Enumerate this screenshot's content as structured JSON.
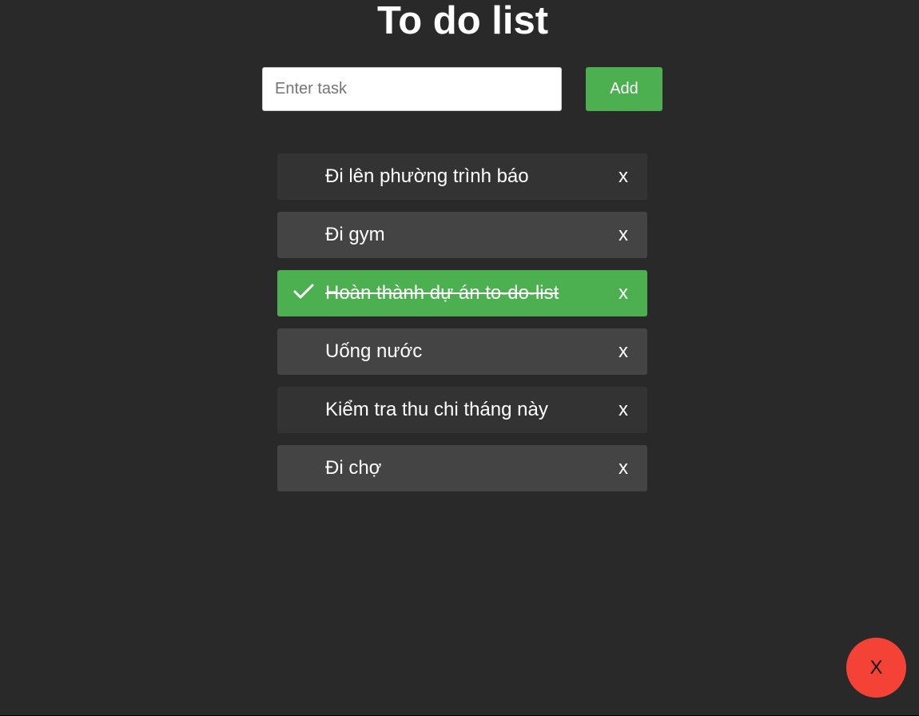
{
  "header": {
    "title": "To do list"
  },
  "form": {
    "input_placeholder": "Enter task",
    "input_value": "",
    "add_label": "Add"
  },
  "todos": [
    {
      "text": "Đi lên phường trình báo",
      "done": false,
      "remove_label": "x"
    },
    {
      "text": "Đi gym",
      "done": false,
      "remove_label": "x"
    },
    {
      "text": "Hoàn thành dự án to-do-list",
      "done": true,
      "remove_label": "x"
    },
    {
      "text": "Uống nước",
      "done": false,
      "remove_label": "x"
    },
    {
      "text": "Kiểm tra thu chi tháng này",
      "done": false,
      "remove_label": "x"
    },
    {
      "text": "Đi chợ",
      "done": false,
      "remove_label": "x"
    }
  ],
  "close_fab": {
    "label": "X"
  },
  "colors": {
    "background": "#292929",
    "item_dark": "#333333",
    "item_light": "#444444",
    "done": "#4caf50",
    "accent": "#4caf50",
    "close": "#f44336"
  },
  "icons": {
    "done_marker": "check-icon"
  }
}
